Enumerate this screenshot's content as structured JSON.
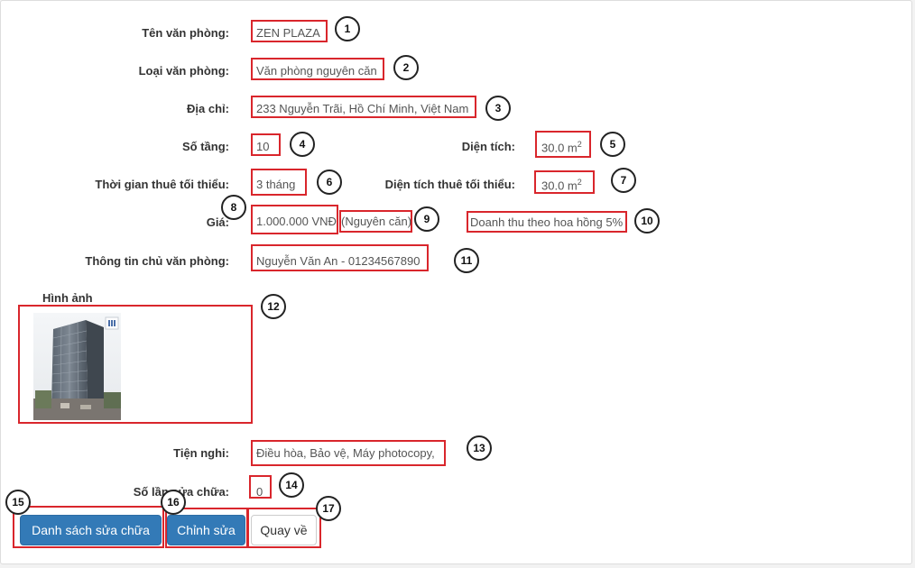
{
  "fields": {
    "name": {
      "label": "Tên văn phòng:",
      "value": "ZEN PLAZA"
    },
    "type": {
      "label": "Loại văn phòng:",
      "value": "Văn phòng nguyên căn"
    },
    "address": {
      "label": "Địa chỉ:",
      "value": "233 Nguyễn Trãi, Hồ Chí Minh, Việt Nam"
    },
    "floors": {
      "label": "Số tầng:",
      "value": "10"
    },
    "area": {
      "label": "Diện tích:",
      "value": "30.0 m",
      "unit_sup": "2"
    },
    "min_rent_time": {
      "label": "Thời gian thuê tối thiểu:",
      "value": "3 tháng"
    },
    "min_rent_area": {
      "label": "Diện tích thuê tối thiểu:",
      "value": "30.0 m",
      "unit_sup": "2"
    },
    "price": {
      "label": "Giá:",
      "value": "1.000.000 VNĐ",
      "unit": "(Nguyên căn)"
    },
    "revenue": {
      "value": "Doanh thu theo hoa hồng 5%"
    },
    "owner": {
      "label": "Thông tin chủ văn phòng:",
      "value": "Nguyễn Văn An - 01234567890"
    },
    "images": {
      "label": "Hình ảnh"
    },
    "amenities": {
      "label": "Tiện nghi:",
      "value": "Điều hòa, Bảo vệ, Máy photocopy,"
    },
    "repairs": {
      "label": "Số lần sửa chữa:",
      "value": "0"
    }
  },
  "buttons": {
    "repair_list": "Danh sách sửa chữa",
    "edit": "Chỉnh sửa",
    "back": "Quay về"
  },
  "badges": [
    "1",
    "2",
    "3",
    "4",
    "5",
    "6",
    "7",
    "8",
    "9",
    "10",
    "11",
    "12",
    "13",
    "14",
    "15",
    "16",
    "17"
  ],
  "colors": {
    "annotation_red": "#d9262c",
    "primary_button": "#337ab7",
    "label_text": "#333333",
    "value_text": "#555555"
  }
}
